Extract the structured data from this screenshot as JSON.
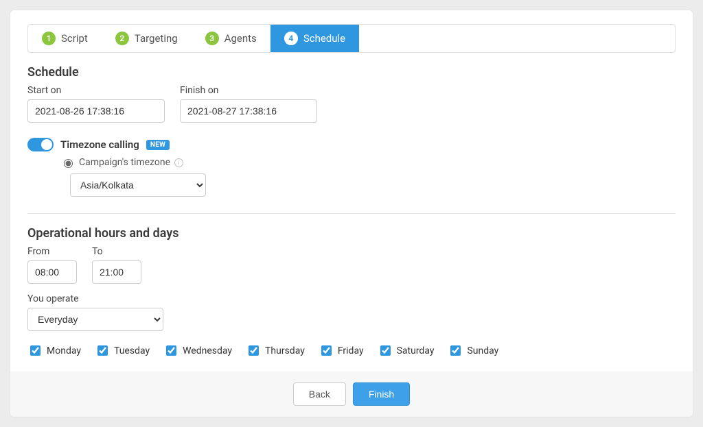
{
  "stepper": {
    "steps": [
      {
        "num": "1",
        "label": "Script"
      },
      {
        "num": "2",
        "label": "Targeting"
      },
      {
        "num": "3",
        "label": "Agents"
      },
      {
        "num": "4",
        "label": "Schedule"
      }
    ]
  },
  "schedule": {
    "title": "Schedule",
    "start_label": "Start on",
    "start_value": "2021-08-26 17:38:16",
    "finish_label": "Finish on",
    "finish_value": "2021-08-27 17:38:16"
  },
  "timezone": {
    "toggle_label": "Timezone calling",
    "new_badge": "NEW",
    "radio_label": "Campaign's timezone",
    "select_value": "Asia/Kolkata"
  },
  "operational": {
    "title": "Operational hours and days",
    "from_label": "From",
    "from_value": "08:00",
    "to_label": "To",
    "to_value": "21:00",
    "operate_label": "You operate",
    "operate_value": "Everyday",
    "days": [
      "Monday",
      "Tuesday",
      "Wednesday",
      "Thursday",
      "Friday",
      "Saturday",
      "Sunday"
    ]
  },
  "footer": {
    "back_label": "Back",
    "finish_label": "Finish"
  }
}
